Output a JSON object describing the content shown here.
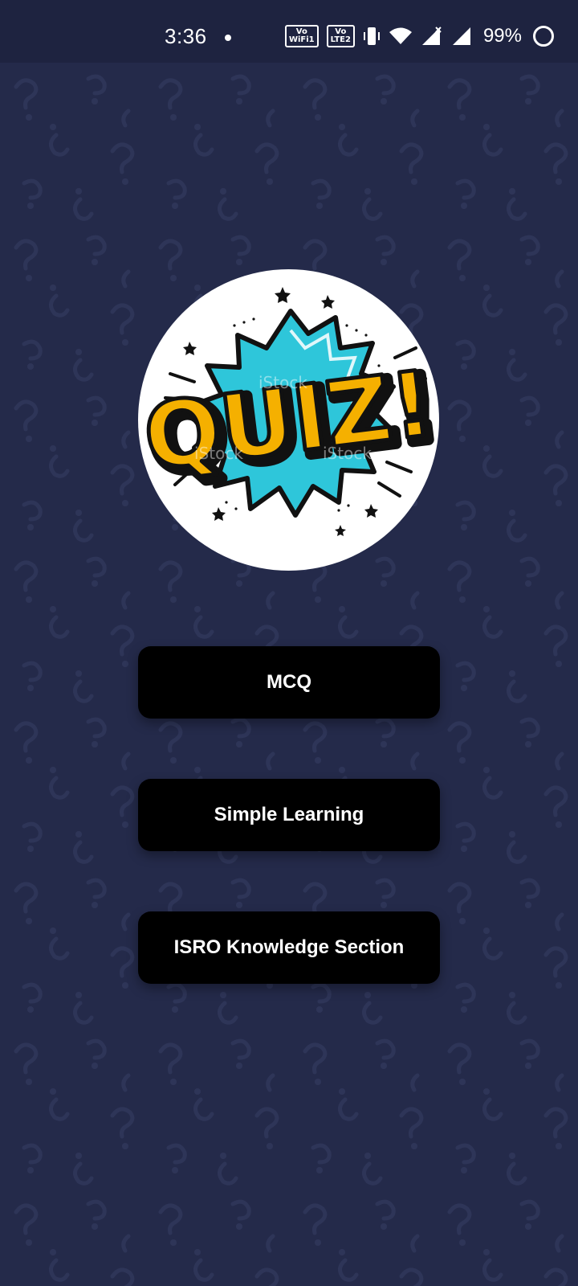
{
  "status_bar": {
    "time": "3:36",
    "wifi_badge": "Vo WiFi 1",
    "lte_badge": "Vo LTE 2",
    "battery_percent": "99%",
    "icons": [
      "notification-dot-icon",
      "vowifi-icon",
      "volte-icon",
      "vibrate-icon",
      "wifi-icon",
      "signal-no-service-icon",
      "signal-icon",
      "battery-saver-icon"
    ]
  },
  "logo": {
    "text": "QUIZ!",
    "watermark": "iStock"
  },
  "menu": {
    "mcq_label": "MCQ",
    "simple_learning_label": "Simple Learning",
    "isro_label": "ISRO Knowledge Section"
  },
  "colors": {
    "background": "#242a4a",
    "status_bar": "#1e2340",
    "button": "#000000",
    "logo_yellow": "#f5b000",
    "logo_cyan": "#2ec6da"
  }
}
